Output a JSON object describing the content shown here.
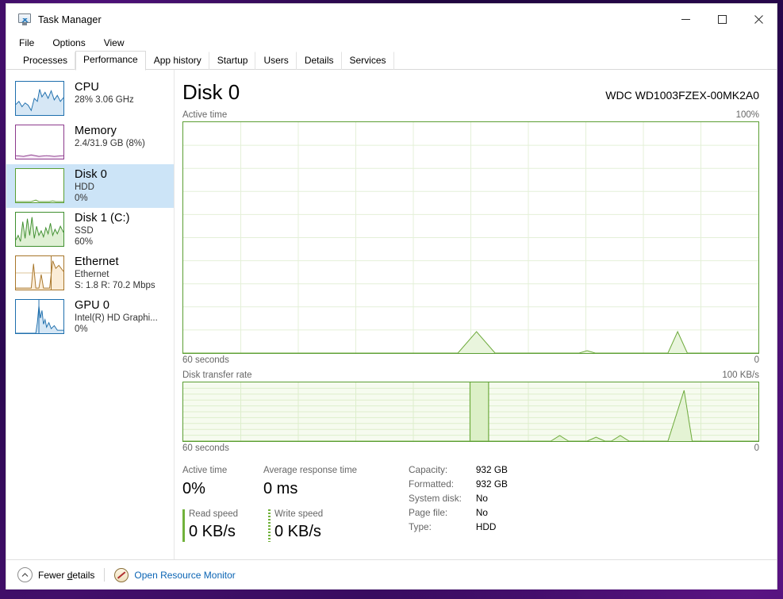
{
  "window": {
    "title": "Task Manager",
    "icon": "task-manager-icon",
    "buttons": {
      "minimize": "—",
      "maximize": "☐",
      "close": "✕"
    }
  },
  "menu": {
    "items": [
      "File",
      "Options",
      "View"
    ]
  },
  "tabs": {
    "items": [
      "Processes",
      "Performance",
      "App history",
      "Startup",
      "Users",
      "Details",
      "Services"
    ],
    "selected": "Performance"
  },
  "sidebar": {
    "items": [
      {
        "title": "CPU",
        "line1": "28%  3.06 GHz",
        "line2": "",
        "selected": false,
        "accent": "#1f6fad",
        "fill": "#e7f1f9"
      },
      {
        "title": "Memory",
        "line1": "2.4/31.9 GB (8%)",
        "line2": "",
        "selected": false,
        "accent": "#8d3a8d",
        "fill": "#fbf2fb"
      },
      {
        "title": "Disk 0",
        "line1": "HDD",
        "line2": "0%",
        "selected": true,
        "accent": "#5a9e32",
        "fill": "#fdfefb"
      },
      {
        "title": "Disk 1 (C:)",
        "line1": "SSD",
        "line2": "60%",
        "selected": false,
        "accent": "#3f8f2f",
        "fill": "#f1f9ec"
      },
      {
        "title": "Ethernet",
        "line1": "Ethernet",
        "line2": "S: 1.8 R: 70.2 Mbps",
        "selected": false,
        "accent": "#a8762a",
        "fill": "#fdf4e6"
      },
      {
        "title": "GPU 0",
        "line1": "Intel(R) HD Graphi...",
        "line2": "0%",
        "selected": false,
        "accent": "#1f6fad",
        "fill": "#ffffff"
      }
    ]
  },
  "main": {
    "title": "Disk 0",
    "model": "WDC WD1003FZEX-00MK2A0",
    "graph1": {
      "label": "Active time",
      "max": "100%",
      "left_axis": "60 seconds",
      "right_axis": "0"
    },
    "graph2": {
      "label": "Disk transfer rate",
      "max": "100 KB/s",
      "left_axis": "60 seconds",
      "right_axis": "0"
    },
    "stats": {
      "active_time": {
        "label": "Active time",
        "value": "0%"
      },
      "avg_response": {
        "label": "Average response time",
        "value": "0 ms"
      },
      "read_speed": {
        "label": "Read speed",
        "value": "0 KB/s"
      },
      "write_speed": {
        "label": "Write speed",
        "value": "0 KB/s"
      },
      "info": [
        {
          "key": "Capacity:",
          "value": "932 GB"
        },
        {
          "key": "Formatted:",
          "value": "932 GB"
        },
        {
          "key": "System disk:",
          "value": "No"
        },
        {
          "key": "Page file:",
          "value": "No"
        },
        {
          "key": "Type:",
          "value": "HDD"
        }
      ]
    }
  },
  "footer": {
    "fewer_details": "Fewer details",
    "fewer_details_pre": "Fewer ",
    "fewer_details_accel": "d",
    "fewer_details_post": "etails",
    "open_resource_monitor": "Open Resource Monitor"
  },
  "chart_data": [
    {
      "type": "area",
      "title": "Active time",
      "ylabel": "Active time",
      "xlabel": "60 seconds",
      "ylim": [
        0,
        100
      ],
      "yunit": "%",
      "grid": true,
      "x": [
        0,
        4,
        8,
        12,
        16,
        20,
        24,
        28,
        32,
        36,
        40,
        44,
        48,
        52,
        56,
        58,
        60,
        62,
        64,
        66,
        68,
        70,
        72,
        74,
        76,
        78,
        80,
        82,
        84,
        86,
        88,
        90,
        92,
        94,
        96,
        100
      ],
      "values": [
        0,
        0,
        0,
        0,
        0,
        0,
        0,
        0,
        0,
        0,
        0,
        0,
        0,
        0,
        0,
        0,
        0,
        0,
        0,
        0,
        0,
        0,
        0,
        0,
        0,
        0,
        0,
        0,
        0,
        0,
        0,
        0,
        0,
        0,
        0,
        0
      ],
      "peaks": [
        {
          "x_pct": 51,
          "height_pct": 9
        },
        {
          "x_pct": 70,
          "height_pct": 1
        },
        {
          "x_pct": 86,
          "height_pct": 9
        }
      ]
    },
    {
      "type": "area",
      "title": "Disk transfer rate",
      "ylabel": "Disk transfer rate",
      "xlabel": "60 seconds",
      "ylim": [
        0,
        100
      ],
      "yunit": "KB/s",
      "grid": true,
      "peaks": [
        {
          "x_pct": 50,
          "height_pct": 100,
          "width_pct": 3
        },
        {
          "x_pct": 66,
          "height_pct": 10
        },
        {
          "x_pct": 72,
          "height_pct": 7
        },
        {
          "x_pct": 76,
          "height_pct": 9
        },
        {
          "x_pct": 87,
          "height_pct": 78
        }
      ]
    }
  ]
}
